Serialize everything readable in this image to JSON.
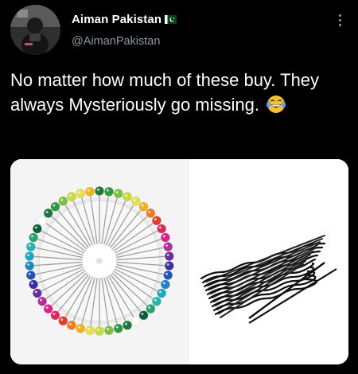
{
  "user": {
    "display_name": "Aiman Pakistan",
    "flag_icon": "pakistan-flag-icon",
    "handle": "@AimanPakistan",
    "avatar_icon": "profile-avatar"
  },
  "tweet": {
    "text": "No matter how much of these buy. They always Mysteriously go missing.",
    "emoji_icon": "face-with-tears-of-joy-icon"
  },
  "media": {
    "image_icon": "pins-and-bobby-pins-photo"
  },
  "colors": {
    "background": "#000000",
    "text": "#ffffff",
    "secondary_text": "#8b98a5",
    "media_background": "#ffffff"
  },
  "more_icon": "more-options-icon"
}
